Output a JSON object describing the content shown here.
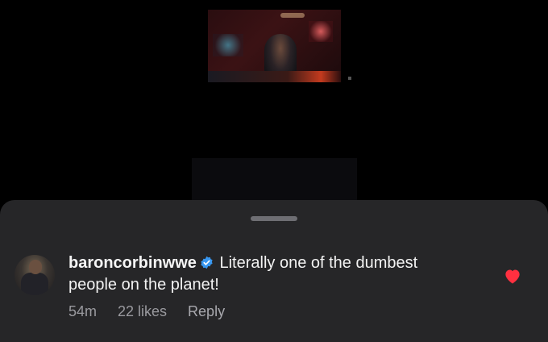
{
  "comment": {
    "username": "baroncorbinwwe",
    "verified": true,
    "text_line1": "Literally one of the dumbest",
    "text_line2": "people on the planet!",
    "time_ago": "54m",
    "likes": "22 likes",
    "reply_label": "Reply",
    "liked": true
  },
  "colors": {
    "sheet_bg": "#262628",
    "heart": "#ff3040",
    "verified_badge": "#3897f0"
  },
  "icons": {
    "verified": "verified-badge-icon",
    "like": "heart-icon"
  }
}
